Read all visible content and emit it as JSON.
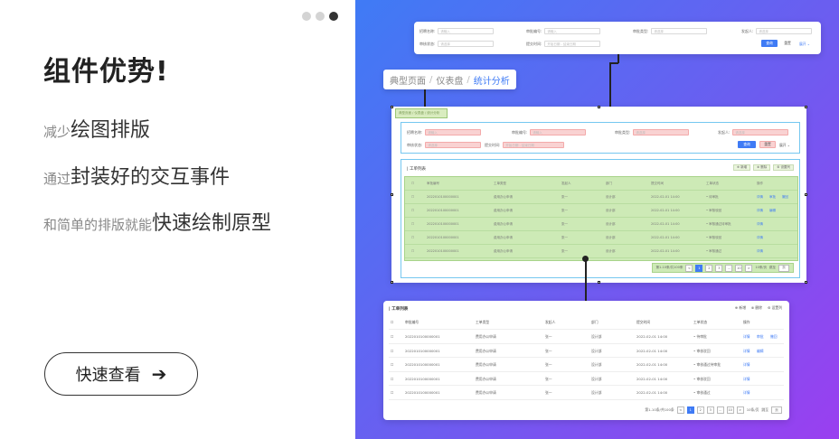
{
  "left": {
    "title": "组件优势!",
    "features": [
      {
        "small": "减少",
        "big": "绘图排版"
      },
      {
        "small": "通过",
        "big": "封装好的交互事件"
      },
      {
        "small": "和简单的排版就能",
        "big": "快速绘制原型"
      }
    ],
    "cta_label": "快速查看",
    "cta_arrow": "➔"
  },
  "breadcrumb": {
    "items": [
      "典型页面",
      "仪表盘",
      "统计分析"
    ],
    "separator": "/"
  },
  "filter_card": {
    "fields": [
      {
        "label": "招聘名称:",
        "placeholder": "请输入"
      },
      {
        "label": "审批编号:",
        "placeholder": "请输入"
      },
      {
        "label": "审批类型:",
        "placeholder": "请选择"
      },
      {
        "label": "发起人:",
        "placeholder": "请选择"
      },
      {
        "label": "审核状态:",
        "placeholder": "请选择"
      },
      {
        "label": "提交时间:",
        "placeholder": "开始日期 - 结束日期"
      }
    ],
    "query_label": "查询",
    "reset_label": "重置",
    "expand_label": "展开 ⌄"
  },
  "mid_card": {
    "crumb": "典型页面 / 仪表盘 / 统计分析",
    "fields": [
      {
        "label": "招聘名称:",
        "placeholder": "请输入"
      },
      {
        "label": "审批编号:",
        "placeholder": "请输入"
      },
      {
        "label": "审批类型:",
        "placeholder": "请选择"
      },
      {
        "label": "发起人:",
        "placeholder": "请选择"
      },
      {
        "label": "审核状态:",
        "placeholder": "请选择"
      },
      {
        "label": "提交时间:",
        "placeholder": "开始日期 - 结束日期"
      }
    ],
    "query_label": "查询",
    "reset_label": "重置",
    "expand_label": "展开 ⌄",
    "table_title": "| 工单列表",
    "tools": [
      "⊕ 新增",
      "⊗ 删除",
      "⚙ 设置列"
    ],
    "columns": [
      "审批编号",
      "工单类型",
      "发起人",
      "部门",
      "提交时间",
      "工单状态",
      "操作"
    ],
    "rows": [
      {
        "id": "2022010100000001",
        "type": "费用办公申请",
        "user": "张一",
        "dept": "设计部",
        "time": "2022-02-01 14:00",
        "status": "• 待审批",
        "ops": [
          "详情",
          "审批",
          "撤回"
        ]
      },
      {
        "id": "2022010100000001",
        "type": "费用办公申请",
        "user": "张一",
        "dept": "设计部",
        "time": "2022-02-01 14:00",
        "status": "• 审核驳回",
        "ops": [
          "详情",
          "编辑"
        ]
      },
      {
        "id": "2022010100000001",
        "type": "费用办公申请",
        "user": "张一",
        "dept": "设计部",
        "time": "2022-02-01 14:00",
        "status": "• 审核通过待审批",
        "ops": [
          "详情"
        ]
      },
      {
        "id": "2022010100000001",
        "type": "费用办公申请",
        "user": "张一",
        "dept": "设计部",
        "time": "2022-02-01 14:00",
        "status": "• 审核驳回",
        "ops": [
          "详情"
        ]
      },
      {
        "id": "2022010100000001",
        "type": "费用办公申请",
        "user": "张一",
        "dept": "设计部",
        "time": "2022-02-01 14:00",
        "status": "• 审核通过",
        "ops": [
          "详情"
        ]
      }
    ],
    "pager": {
      "total": "第1-10条/共100条",
      "pages": [
        "<",
        "1",
        "2",
        "3",
        "...",
        "10",
        ">"
      ],
      "size": "10条/页",
      "jump": "跳至",
      "jump_input": "页"
    }
  },
  "bottom_card": {
    "title": "| 工单列表",
    "tools": [
      "⊕ 新增",
      "⊗ 删除",
      "⚙ 设置列"
    ],
    "columns": [
      "审批编号",
      "工单类型",
      "发起人",
      "部门",
      "提交时间",
      "工单状态",
      "操作"
    ],
    "rows": [
      {
        "id": "2022010100000001",
        "type": "费用办公申请",
        "user": "张一",
        "dept": "设计部",
        "time": "2022-02-01 14:00",
        "status": "• 待审批",
        "ops": [
          "详情",
          "审批",
          "撤回"
        ]
      },
      {
        "id": "2022010100000001",
        "type": "费用办公申请",
        "user": "张一",
        "dept": "设计部",
        "time": "2022-02-01 14:00",
        "status": "• 审核驳回",
        "ops": [
          "详情",
          "编辑"
        ]
      },
      {
        "id": "2022010100000001",
        "type": "费用办公申请",
        "user": "张一",
        "dept": "设计部",
        "time": "2022-02-01 14:00",
        "status": "• 审核通过待审批",
        "ops": [
          "详情"
        ]
      },
      {
        "id": "2022010100000001",
        "type": "费用办公申请",
        "user": "张一",
        "dept": "设计部",
        "time": "2022-02-01 14:00",
        "status": "• 审核驳回",
        "ops": [
          "详情"
        ]
      },
      {
        "id": "2022010100000001",
        "type": "费用办公申请",
        "user": "张一",
        "dept": "设计部",
        "time": "2022-02-01 14:00",
        "status": "• 审核通过",
        "ops": [
          "详情"
        ]
      }
    ],
    "pager": {
      "total": "第1-10条/共100条",
      "pages": [
        "<",
        "1",
        "2",
        "3",
        "...",
        "10",
        ">"
      ],
      "size": "10条/页",
      "jump": "跳至",
      "jump_input": "页"
    }
  },
  "colors": {
    "accent": "#3f7bf5",
    "gradient_start": "#3f7bf5",
    "gradient_end": "#9a3ff0"
  }
}
